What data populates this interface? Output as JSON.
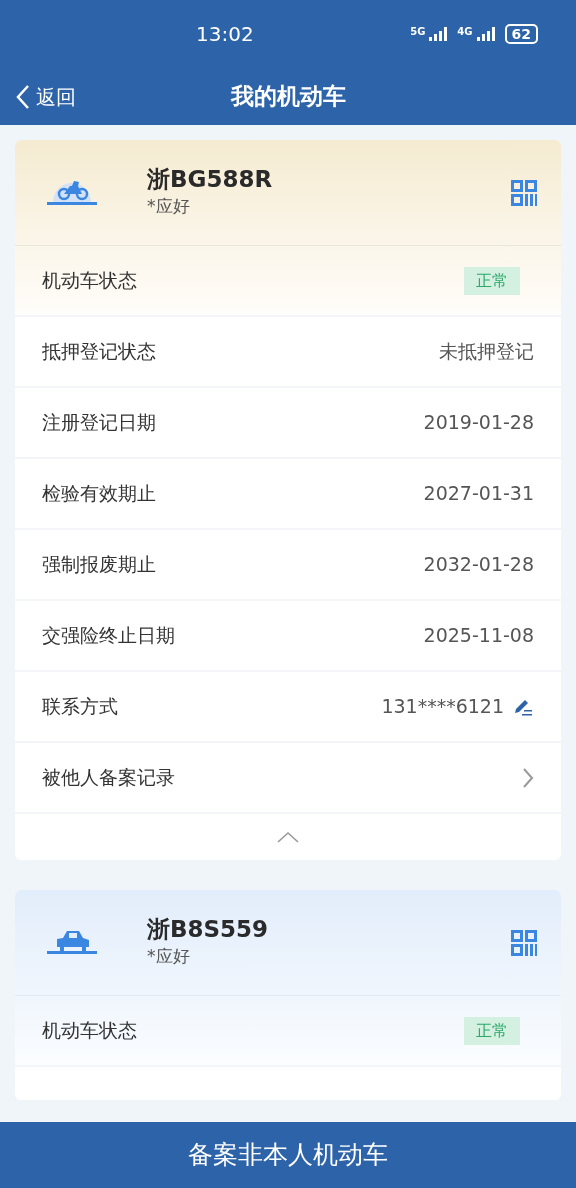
{
  "status_bar": {
    "time": "13:02",
    "network_1": "5G",
    "network_2": "4G",
    "battery": "62"
  },
  "nav": {
    "back": "返回",
    "title": "我的机动车"
  },
  "vehicles": [
    {
      "kind": "motorcycle",
      "plate": "浙BG588R",
      "owner": "*应好",
      "expanded": true,
      "rows": [
        {
          "kind": "status",
          "label": "机动车状态",
          "value": "正常"
        },
        {
          "kind": "text",
          "label": "抵押登记状态",
          "value": "未抵押登记"
        },
        {
          "kind": "text",
          "label": "注册登记日期",
          "value": "2019-01-28"
        },
        {
          "kind": "text",
          "label": "检验有效期止",
          "value": "2027-01-31"
        },
        {
          "kind": "text",
          "label": "强制报废期止",
          "value": "2032-01-28"
        },
        {
          "kind": "text",
          "label": "交强险终止日期",
          "value": "2025-11-08"
        },
        {
          "kind": "phone",
          "label": "联系方式",
          "value": "131****6121"
        },
        {
          "kind": "link",
          "label": "被他人备案记录"
        }
      ]
    },
    {
      "kind": "car",
      "plate": "浙B8S559",
      "owner": "*应好",
      "rows": [
        {
          "kind": "status",
          "label": "机动车状态",
          "value": "正常"
        }
      ]
    }
  ],
  "footer_button": "备案非本人机动车"
}
